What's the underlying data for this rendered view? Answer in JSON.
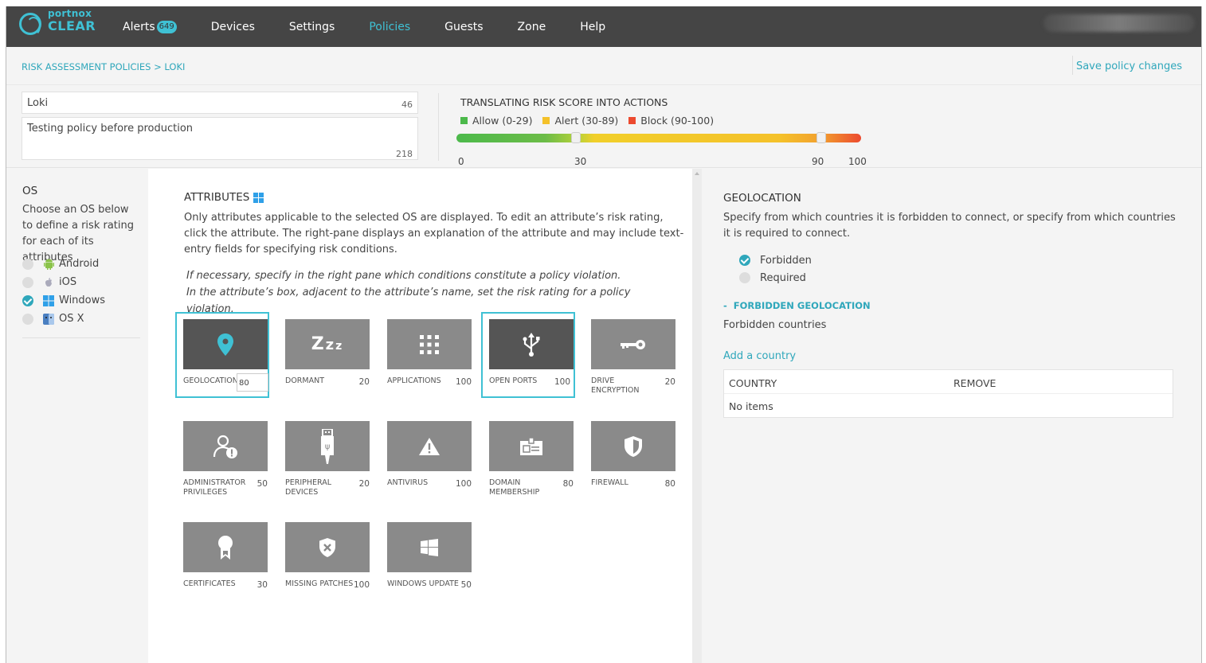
{
  "nav": {
    "logo_top": "portnox",
    "logo_bottom": "CLEAR",
    "items": [
      {
        "label": "Alerts",
        "badge": "649"
      },
      {
        "label": "Devices"
      },
      {
        "label": "Settings"
      },
      {
        "label": "Policies"
      },
      {
        "label": "Guests"
      },
      {
        "label": "Zone"
      },
      {
        "label": "Help"
      }
    ],
    "active": "Policies"
  },
  "breadcrumb": "RISK ASSESSMENT POLICIES > LOKI",
  "save_label": "Save policy changes",
  "policy": {
    "name": "Loki",
    "name_count": "46",
    "description": "Testing policy before production",
    "desc_count": "218"
  },
  "risk": {
    "title": "TRANSLATING RISK SCORE INTO ACTIONS",
    "legend": [
      {
        "label": "Allow (0-29)",
        "color": "#4cb94b"
      },
      {
        "label": "Alert (30-89)",
        "color": "#f4c12a"
      },
      {
        "label": "Block (90-100)",
        "color": "#ec4a2f"
      }
    ],
    "ticks": [
      "0",
      "30",
      "90",
      "100"
    ],
    "thresholds": [
      30,
      90
    ]
  },
  "os": {
    "heading": "OS",
    "description": "Choose an OS below to define a risk rating for each of its attributes",
    "items": [
      {
        "label": "Android",
        "selected": false,
        "icon": "android-icon"
      },
      {
        "label": "iOS",
        "selected": false,
        "icon": "apple-icon"
      },
      {
        "label": "Windows",
        "selected": true,
        "icon": "windows-icon"
      },
      {
        "label": "OS X",
        "selected": false,
        "icon": "finder-icon"
      }
    ]
  },
  "attributes": {
    "heading": "ATTRIBUTES",
    "description": "Only attributes applicable to the selected OS are displayed. To edit an attribute’s risk rating, click the attribute. The right-pane displays an explanation of the attribute and may include text-entry fields for specifying risk conditions.",
    "italic_1": "If necessary, specify in the right pane which conditions constitute a policy violation.",
    "italic_2": "In the attribute’s box, adjacent to the attribute’s name, set the risk rating for a policy violation.",
    "tiles": [
      {
        "label": "GEOLOCATION",
        "value": "80",
        "icon": "location-pin-icon",
        "selected": true,
        "editing": true
      },
      {
        "label": "DORMANT",
        "value": "20",
        "icon": "sleep-icon"
      },
      {
        "label": "APPLICATIONS",
        "value": "100",
        "icon": "apps-grid-icon"
      },
      {
        "label": "OPEN PORTS",
        "value": "100",
        "icon": "usb-icon",
        "selected": true
      },
      {
        "label": "DRIVE ENCRYPTION",
        "value": "20",
        "icon": "key-icon"
      },
      {
        "label": "ADMINISTRATOR PRIVILEGES",
        "value": "50",
        "icon": "admin-user-icon"
      },
      {
        "label": "PERIPHERAL DEVICES",
        "value": "20",
        "icon": "usb-stick-icon"
      },
      {
        "label": "ANTIVIRUS",
        "value": "100",
        "icon": "warning-icon"
      },
      {
        "label": "DOMAIN MEMBERSHIP",
        "value": "80",
        "icon": "id-card-icon"
      },
      {
        "label": "FIREWALL",
        "value": "80",
        "icon": "shield-icon"
      },
      {
        "label": "CERTIFICATES",
        "value": "30",
        "icon": "award-icon"
      },
      {
        "label": "MISSING PATCHES",
        "value": "100",
        "icon": "shield-x-icon"
      },
      {
        "label": "WINDOWS UPDATE",
        "value": "50",
        "icon": "windows-icon"
      }
    ]
  },
  "geo": {
    "heading": "GEOLOCATION",
    "description": "Specify from which countries it is forbidden to connect, or specify from which countries it is required to connect.",
    "options": [
      {
        "label": "Forbidden",
        "selected": true
      },
      {
        "label": "Required",
        "selected": false
      }
    ],
    "subheading": "FORBIDDEN GEOLOCATION",
    "forbidden_label": "Forbidden countries",
    "add_label": "Add a country",
    "table": {
      "col_country": "COUNTRY",
      "col_remove": "REMOVE",
      "empty": "No items"
    }
  }
}
